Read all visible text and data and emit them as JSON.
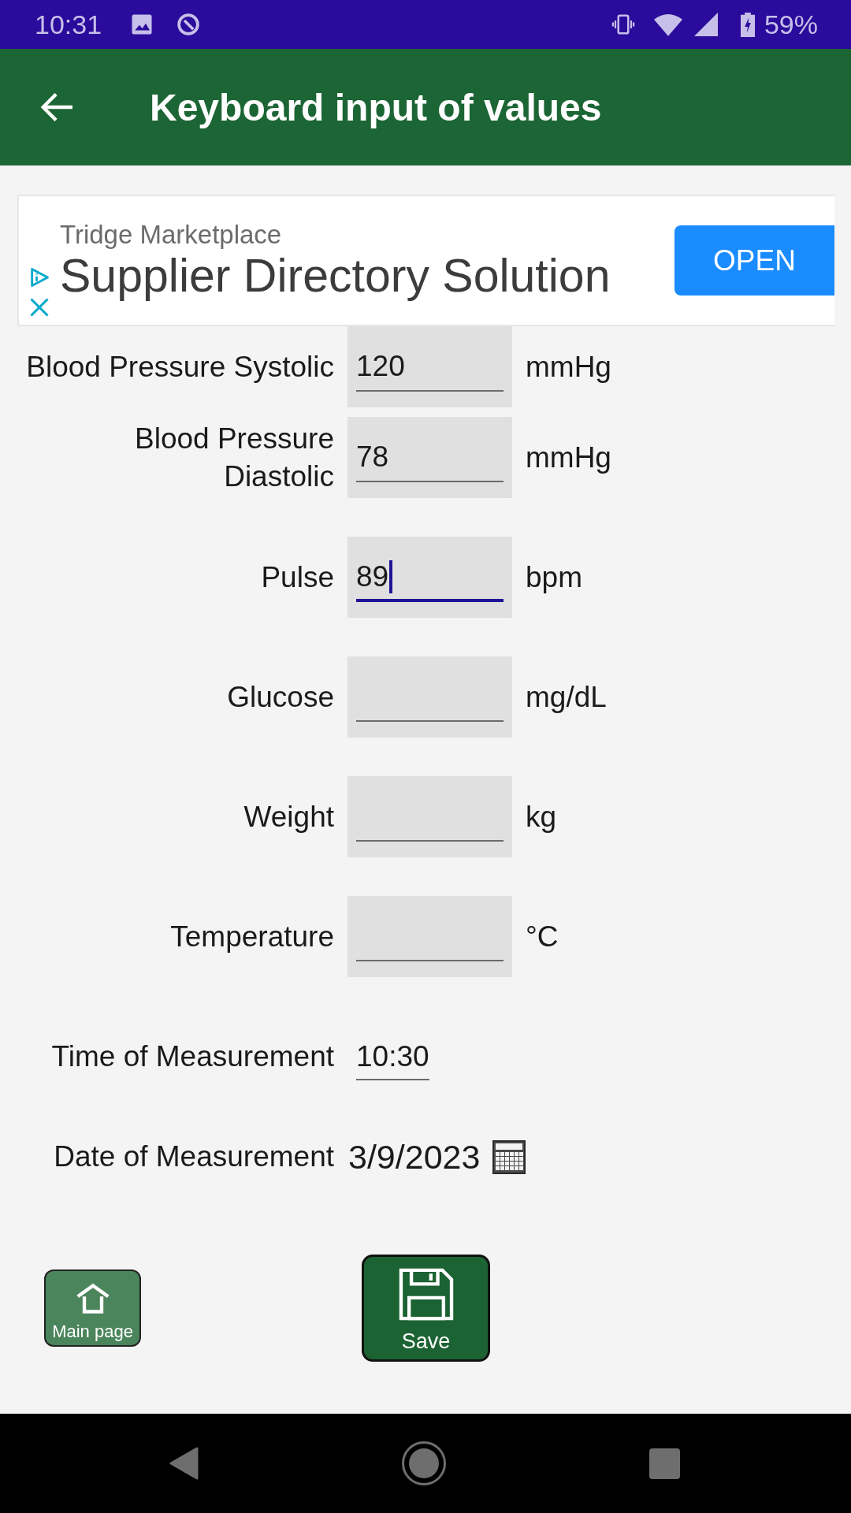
{
  "status_bar": {
    "time": "10:31",
    "battery": "59%"
  },
  "app_bar": {
    "title": "Keyboard input of values"
  },
  "ad": {
    "advertiser": "Tridge Marketplace",
    "headline": "Supplier Directory Solution",
    "button": "OPEN"
  },
  "fields": [
    {
      "label": "Blood Pressure Systolic",
      "value": "120",
      "unit": "mmHg",
      "focused": false
    },
    {
      "label": "Blood Pressure Diastolic",
      "value": "78",
      "unit": "mmHg",
      "focused": false
    },
    {
      "label": "Pulse",
      "value": "89",
      "unit": "bpm",
      "focused": true
    },
    {
      "label": "Glucose",
      "unit": "mg/dL",
      "focused": false
    },
    {
      "label": "Weight",
      "unit": "kg",
      "focused": false
    },
    {
      "label": "Temperature",
      "unit": "°C",
      "focused": false
    }
  ],
  "time_of_measurement": {
    "label": "Time of Measurement",
    "value": "10:30"
  },
  "date_of_measurement": {
    "label": "Date of Measurement",
    "value": "3/9/2023"
  },
  "buttons": [
    {
      "kind": "home",
      "label": "Main page"
    },
    {
      "kind": "save",
      "label": "Save"
    }
  ]
}
